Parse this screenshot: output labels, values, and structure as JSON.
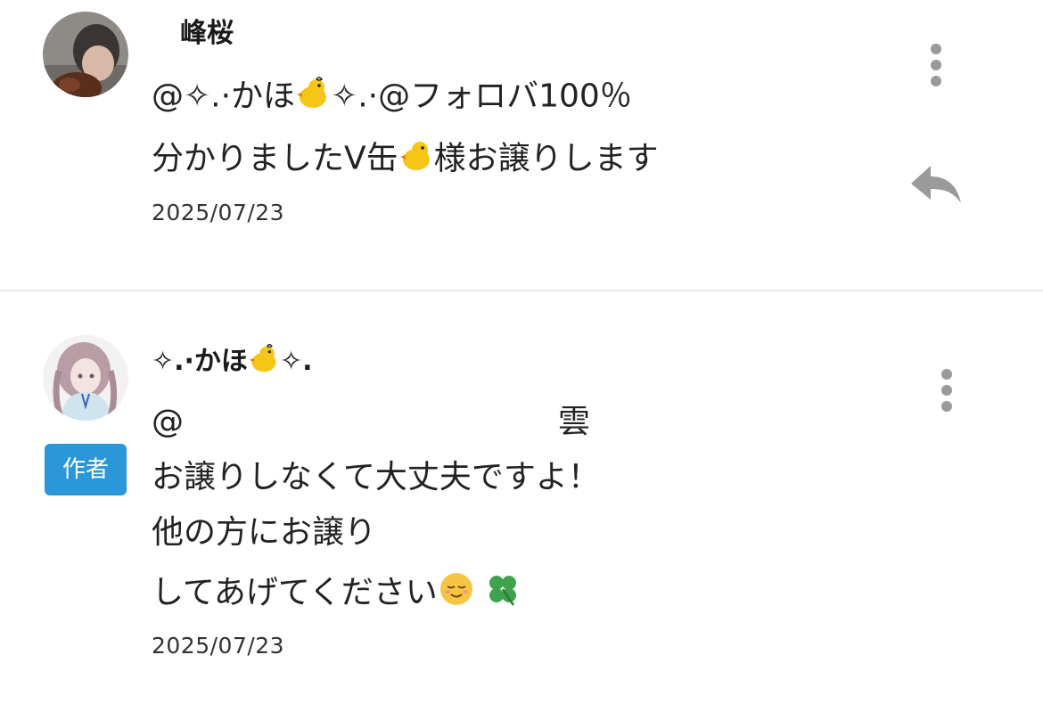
{
  "comments": [
    {
      "username": "峰桜",
      "mention": "@✧.·かほ",
      "mention_tail": "✧.·@フォロバ100％",
      "line2_a": "分かりましたV缶",
      "line2_b": "様お譲りします",
      "date": "2025/07/23",
      "avatar_icon": "user-avatar-photo",
      "menu_icon": "kebab-menu-icon",
      "reply_icon": "reply-arrow-icon"
    },
    {
      "username_a": "✧.·かほ",
      "username_b": "✧.",
      "mention_prefix": "@",
      "mention_end": "雲",
      "line2": "お譲りしなくて大丈夫ですよ！",
      "line3": "他の方にお譲り",
      "line4": "してあげてください",
      "date": "2025/07/23",
      "badge": "作者",
      "badge_color": "#2a97d9",
      "avatar_icon": "user-avatar-illustration",
      "menu_icon": "kebab-menu-icon",
      "emojis": [
        "chick-emoji",
        "relieved-face-emoji",
        "four-leaf-clover-emoji"
      ]
    }
  ],
  "colors": {
    "divider": "#e8e8e8",
    "icon_gray": "#9a9a9a",
    "text": "#222222"
  }
}
